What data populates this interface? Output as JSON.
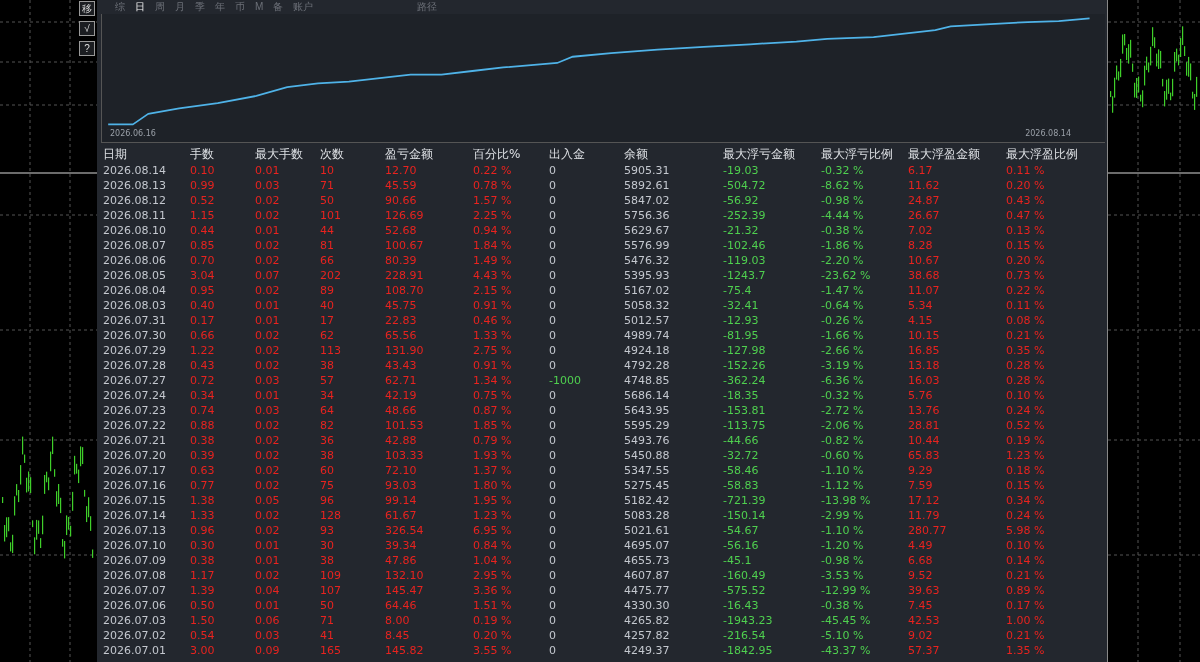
{
  "tool_buttons": [
    "移",
    "√",
    "?"
  ],
  "tabs": [
    {
      "label": "综",
      "selected": false
    },
    {
      "label": "日",
      "selected": true
    },
    {
      "label": "周",
      "selected": false
    },
    {
      "label": "月",
      "selected": false
    },
    {
      "label": "季",
      "selected": false
    },
    {
      "label": "年",
      "selected": false
    },
    {
      "label": "币",
      "selected": false
    },
    {
      "label": "M",
      "selected": false
    },
    {
      "label": "备",
      "selected": false
    },
    {
      "label": "账户",
      "selected": false
    },
    {
      "label": "路径",
      "selected": false
    }
  ],
  "equity_chart": {
    "start_label": "2026.06.16",
    "end_label": "2026.08.14"
  },
  "table": {
    "columns": [
      {
        "label": "日期",
        "color": "#c4c8cf"
      },
      {
        "label": "手数",
        "color": "#e8231f"
      },
      {
        "label": "最大手数",
        "color": "#e8231f"
      },
      {
        "label": "次数",
        "color": "#e8231f"
      },
      {
        "label": "盈亏金额",
        "color": "#e8231f"
      },
      {
        "label": "百分比%",
        "color": "#e8231f"
      },
      {
        "label": "出入金",
        "color": "#c4c8cf"
      },
      {
        "label": "余额",
        "color": "#c4c8cf"
      },
      {
        "label": "最大浮亏金额",
        "color": "#4fd04f"
      },
      {
        "label": "最大浮亏比例",
        "color": "#4fd04f"
      },
      {
        "label": "最大浮盈金额",
        "color": "#e8231f"
      },
      {
        "label": "最大浮盈比例",
        "color": "#e8231f"
      }
    ],
    "rows": [
      {
        "withdrawal": false,
        "cells": [
          "2026.08.14",
          "0.10",
          "0.01",
          "10",
          "12.70",
          "0.22 %",
          "0",
          "5905.31",
          "-19.03",
          "-0.32 %",
          "6.17",
          "0.11 %"
        ]
      },
      {
        "withdrawal": false,
        "cells": [
          "2026.08.13",
          "0.99",
          "0.03",
          "71",
          "45.59",
          "0.78 %",
          "0",
          "5892.61",
          "-504.72",
          "-8.62 %",
          "11.62",
          "0.20 %"
        ]
      },
      {
        "withdrawal": false,
        "cells": [
          "2026.08.12",
          "0.52",
          "0.02",
          "50",
          "90.66",
          "1.57 %",
          "0",
          "5847.02",
          "-56.92",
          "-0.98 %",
          "24.87",
          "0.43 %"
        ]
      },
      {
        "withdrawal": false,
        "cells": [
          "2026.08.11",
          "1.15",
          "0.02",
          "101",
          "126.69",
          "2.25 %",
          "0",
          "5756.36",
          "-252.39",
          "-4.44 %",
          "26.67",
          "0.47 %"
        ]
      },
      {
        "withdrawal": false,
        "cells": [
          "2026.08.10",
          "0.44",
          "0.01",
          "44",
          "52.68",
          "0.94 %",
          "0",
          "5629.67",
          "-21.32",
          "-0.38 %",
          "7.02",
          "0.13 %"
        ]
      },
      {
        "withdrawal": false,
        "cells": [
          "2026.08.07",
          "0.85",
          "0.02",
          "81",
          "100.67",
          "1.84 %",
          "0",
          "5576.99",
          "-102.46",
          "-1.86 %",
          "8.28",
          "0.15 %"
        ]
      },
      {
        "withdrawal": false,
        "cells": [
          "2026.08.06",
          "0.70",
          "0.02",
          "66",
          "80.39",
          "1.49 %",
          "0",
          "5476.32",
          "-119.03",
          "-2.20 %",
          "10.67",
          "0.20 %"
        ]
      },
      {
        "withdrawal": false,
        "cells": [
          "2026.08.05",
          "3.04",
          "0.07",
          "202",
          "228.91",
          "4.43 %",
          "0",
          "5395.93",
          "-1243.7",
          "-23.62 %",
          "38.68",
          "0.73 %"
        ]
      },
      {
        "withdrawal": false,
        "cells": [
          "2026.08.04",
          "0.95",
          "0.02",
          "89",
          "108.70",
          "2.15 %",
          "0",
          "5167.02",
          "-75.4",
          "-1.47 %",
          "11.07",
          "0.22 %"
        ]
      },
      {
        "withdrawal": false,
        "cells": [
          "2026.08.03",
          "0.40",
          "0.01",
          "40",
          "45.75",
          "0.91 %",
          "0",
          "5058.32",
          "-32.41",
          "-0.64 %",
          "5.34",
          "0.11 %"
        ]
      },
      {
        "withdrawal": false,
        "cells": [
          "2026.07.31",
          "0.17",
          "0.01",
          "17",
          "22.83",
          "0.46 %",
          "0",
          "5012.57",
          "-12.93",
          "-0.26 %",
          "4.15",
          "0.08 %"
        ]
      },
      {
        "withdrawal": false,
        "cells": [
          "2026.07.30",
          "0.66",
          "0.02",
          "62",
          "65.56",
          "1.33 %",
          "0",
          "4989.74",
          "-81.95",
          "-1.66 %",
          "10.15",
          "0.21 %"
        ]
      },
      {
        "withdrawal": false,
        "cells": [
          "2026.07.29",
          "1.22",
          "0.02",
          "113",
          "131.90",
          "2.75 %",
          "0",
          "4924.18",
          "-127.98",
          "-2.66 %",
          "16.85",
          "0.35 %"
        ]
      },
      {
        "withdrawal": false,
        "cells": [
          "2026.07.28",
          "0.43",
          "0.02",
          "38",
          "43.43",
          "0.91 %",
          "0",
          "4792.28",
          "-152.26",
          "-3.19 %",
          "13.18",
          "0.28 %"
        ]
      },
      {
        "withdrawal": true,
        "cells": [
          "2026.07.27",
          "0.72",
          "0.03",
          "57",
          "62.71",
          "1.34 %",
          "-1000",
          "4748.85",
          "-362.24",
          "-6.36 %",
          "16.03",
          "0.28 %"
        ]
      },
      {
        "withdrawal": false,
        "cells": [
          "2026.07.24",
          "0.34",
          "0.01",
          "34",
          "42.19",
          "0.75 %",
          "0",
          "5686.14",
          "-18.35",
          "-0.32 %",
          "5.76",
          "0.10 %"
        ]
      },
      {
        "withdrawal": false,
        "cells": [
          "2026.07.23",
          "0.74",
          "0.03",
          "64",
          "48.66",
          "0.87 %",
          "0",
          "5643.95",
          "-153.81",
          "-2.72 %",
          "13.76",
          "0.24 %"
        ]
      },
      {
        "withdrawal": false,
        "cells": [
          "2026.07.22",
          "0.88",
          "0.02",
          "82",
          "101.53",
          "1.85 %",
          "0",
          "5595.29",
          "-113.75",
          "-2.06 %",
          "28.81",
          "0.52 %"
        ]
      },
      {
        "withdrawal": false,
        "cells": [
          "2026.07.21",
          "0.38",
          "0.02",
          "36",
          "42.88",
          "0.79 %",
          "0",
          "5493.76",
          "-44.66",
          "-0.82 %",
          "10.44",
          "0.19 %"
        ]
      },
      {
        "withdrawal": false,
        "cells": [
          "2026.07.20",
          "0.39",
          "0.02",
          "38",
          "103.33",
          "1.93 %",
          "0",
          "5450.88",
          "-32.72",
          "-0.60 %",
          "65.83",
          "1.23 %"
        ]
      },
      {
        "withdrawal": false,
        "cells": [
          "2026.07.17",
          "0.63",
          "0.02",
          "60",
          "72.10",
          "1.37 %",
          "0",
          "5347.55",
          "-58.46",
          "-1.10 %",
          "9.29",
          "0.18 %"
        ]
      },
      {
        "withdrawal": false,
        "cells": [
          "2026.07.16",
          "0.77",
          "0.02",
          "75",
          "93.03",
          "1.80 %",
          "0",
          "5275.45",
          "-58.83",
          "-1.12 %",
          "7.59",
          "0.15 %"
        ]
      },
      {
        "withdrawal": false,
        "cells": [
          "2026.07.15",
          "1.38",
          "0.05",
          "96",
          "99.14",
          "1.95 %",
          "0",
          "5182.42",
          "-721.39",
          "-13.98 %",
          "17.12",
          "0.34 %"
        ]
      },
      {
        "withdrawal": false,
        "cells": [
          "2026.07.14",
          "1.33",
          "0.02",
          "128",
          "61.67",
          "1.23 %",
          "0",
          "5083.28",
          "-150.14",
          "-2.99 %",
          "11.79",
          "0.24 %"
        ]
      },
      {
        "withdrawal": false,
        "cells": [
          "2026.07.13",
          "0.96",
          "0.02",
          "93",
          "326.54",
          "6.95 %",
          "0",
          "5021.61",
          "-54.67",
          "-1.10 %",
          "280.77",
          "5.98 %"
        ]
      },
      {
        "withdrawal": false,
        "cells": [
          "2026.07.10",
          "0.30",
          "0.01",
          "30",
          "39.34",
          "0.84 %",
          "0",
          "4695.07",
          "-56.16",
          "-1.20 %",
          "4.49",
          "0.10 %"
        ]
      },
      {
        "withdrawal": false,
        "cells": [
          "2026.07.09",
          "0.38",
          "0.01",
          "38",
          "47.86",
          "1.04 %",
          "0",
          "4655.73",
          "-45.1",
          "-0.98 %",
          "6.68",
          "0.14 %"
        ]
      },
      {
        "withdrawal": false,
        "cells": [
          "2026.07.08",
          "1.17",
          "0.02",
          "109",
          "132.10",
          "2.95 %",
          "0",
          "4607.87",
          "-160.49",
          "-3.53 %",
          "9.52",
          "0.21 %"
        ]
      },
      {
        "withdrawal": false,
        "cells": [
          "2026.07.07",
          "1.39",
          "0.04",
          "107",
          "145.47",
          "3.36 %",
          "0",
          "4475.77",
          "-575.52",
          "-12.99 %",
          "39.63",
          "0.89 %"
        ]
      },
      {
        "withdrawal": false,
        "cells": [
          "2026.07.06",
          "0.50",
          "0.01",
          "50",
          "64.46",
          "1.51 %",
          "0",
          "4330.30",
          "-16.43",
          "-0.38 %",
          "7.45",
          "0.17 %"
        ]
      },
      {
        "withdrawal": false,
        "cells": [
          "2026.07.03",
          "1.50",
          "0.06",
          "71",
          "8.00",
          "0.19 %",
          "0",
          "4265.82",
          "-1943.23",
          "-45.45 %",
          "42.53",
          "1.00 %"
        ]
      },
      {
        "withdrawal": false,
        "cells": [
          "2026.07.02",
          "0.54",
          "0.03",
          "41",
          "8.45",
          "0.20 %",
          "0",
          "4257.82",
          "-216.54",
          "-5.10 %",
          "9.02",
          "0.21 %"
        ]
      },
      {
        "withdrawal": false,
        "cells": [
          "2026.07.01",
          "3.00",
          "0.09",
          "165",
          "145.82",
          "3.55 %",
          "0",
          "4249.37",
          "-1842.95",
          "-43.37 %",
          "57.37",
          "1.35 %"
        ]
      }
    ]
  }
}
